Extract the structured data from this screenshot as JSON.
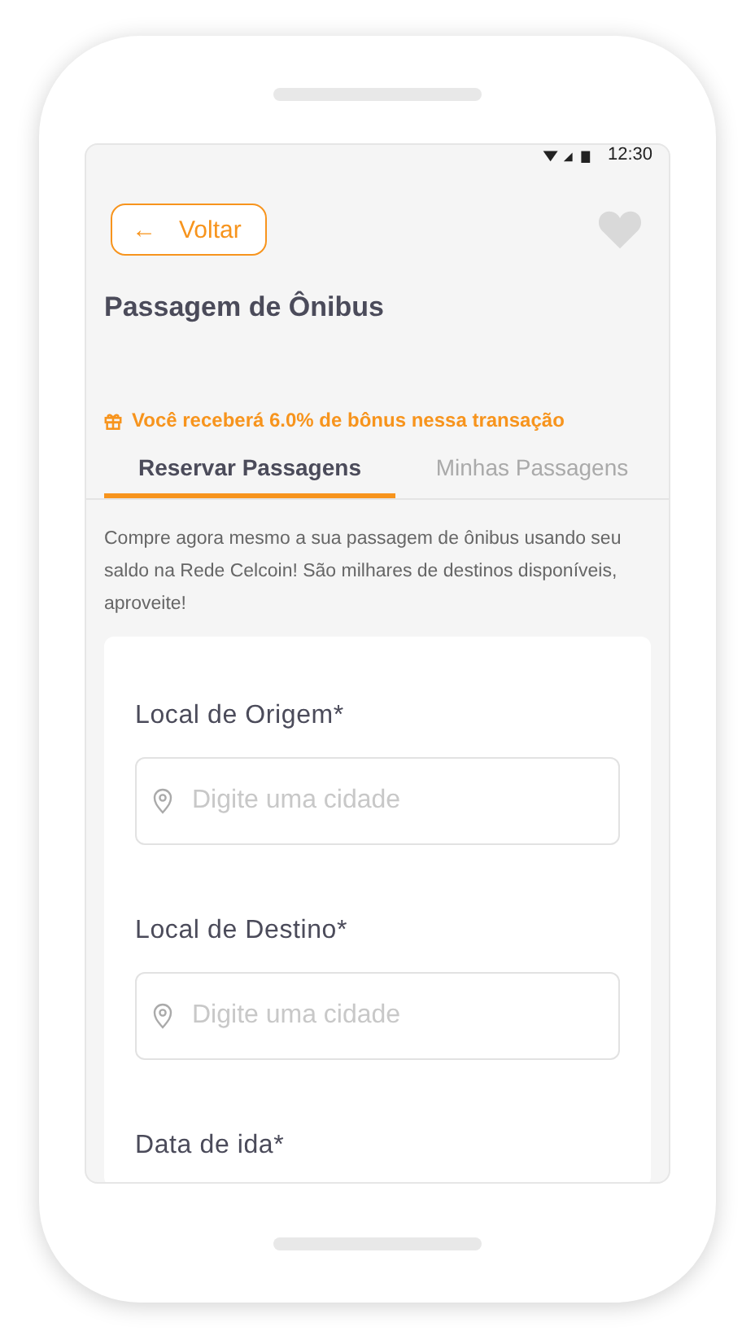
{
  "status_bar": {
    "time": "12:30"
  },
  "header": {
    "back_button": {
      "arrow": "←",
      "label": "Voltar"
    },
    "title": "Passagem de Ônibus"
  },
  "bonus": {
    "text": "Você receberá 6.0% de bônus nessa transação"
  },
  "tabs": [
    {
      "label": "Reservar Passagens",
      "selected": true
    },
    {
      "label": "Minhas Passagens",
      "selected": false
    }
  ],
  "description": "Compre agora mesmo a sua passagem de ônibus usando seu saldo na Rede Celcoin! São milhares de destinos disponíveis, aproveite!",
  "form": {
    "fields": [
      {
        "kind": "city",
        "label": "Local de Origem*",
        "placeholder": "Digite uma cidade"
      },
      {
        "kind": "city",
        "label": "Local de Destino*",
        "placeholder": "Digite uma cidade"
      },
      {
        "kind": "date",
        "label": "Data de ida*"
      }
    ]
  }
}
